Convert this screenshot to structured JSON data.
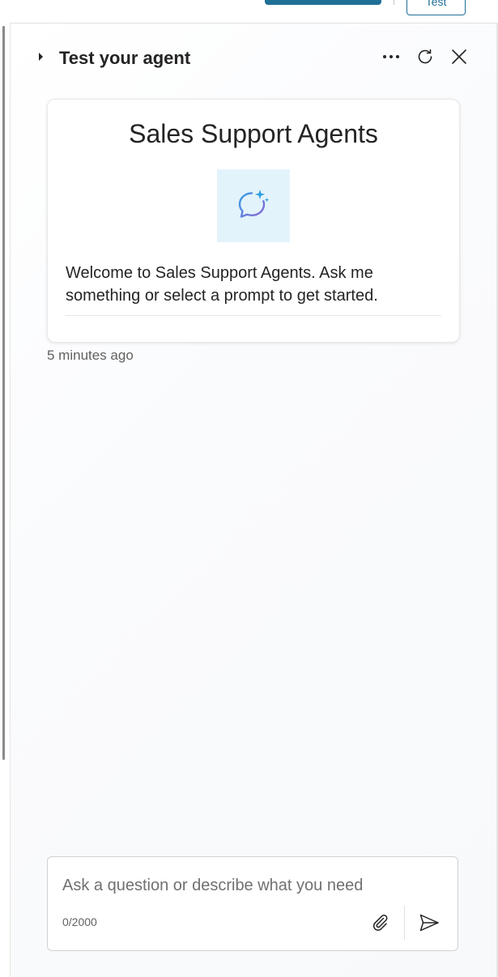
{
  "topbar": {
    "test_label": "Test"
  },
  "panel": {
    "title": "Test your agent"
  },
  "welcome": {
    "agent_name": "Sales Support Agents",
    "message": "Welcome to Sales Support Agents. Ask me something or select a prompt to get started.",
    "timestamp": "5 minutes ago"
  },
  "composer": {
    "placeholder": "Ask a question or describe what you need",
    "value": "",
    "char_count": "0/2000"
  },
  "icons": {
    "collapse": "caret-right-icon",
    "more": "more-horizontal-icon",
    "refresh": "refresh-icon",
    "close": "close-icon",
    "agent": "chat-sparkle-icon",
    "attach": "paperclip-icon",
    "send": "send-icon"
  },
  "colors": {
    "accent": "#1f6f97",
    "avatar_bg": "#e3f3fb",
    "text_primary": "#242424",
    "text_secondary": "#616161"
  }
}
